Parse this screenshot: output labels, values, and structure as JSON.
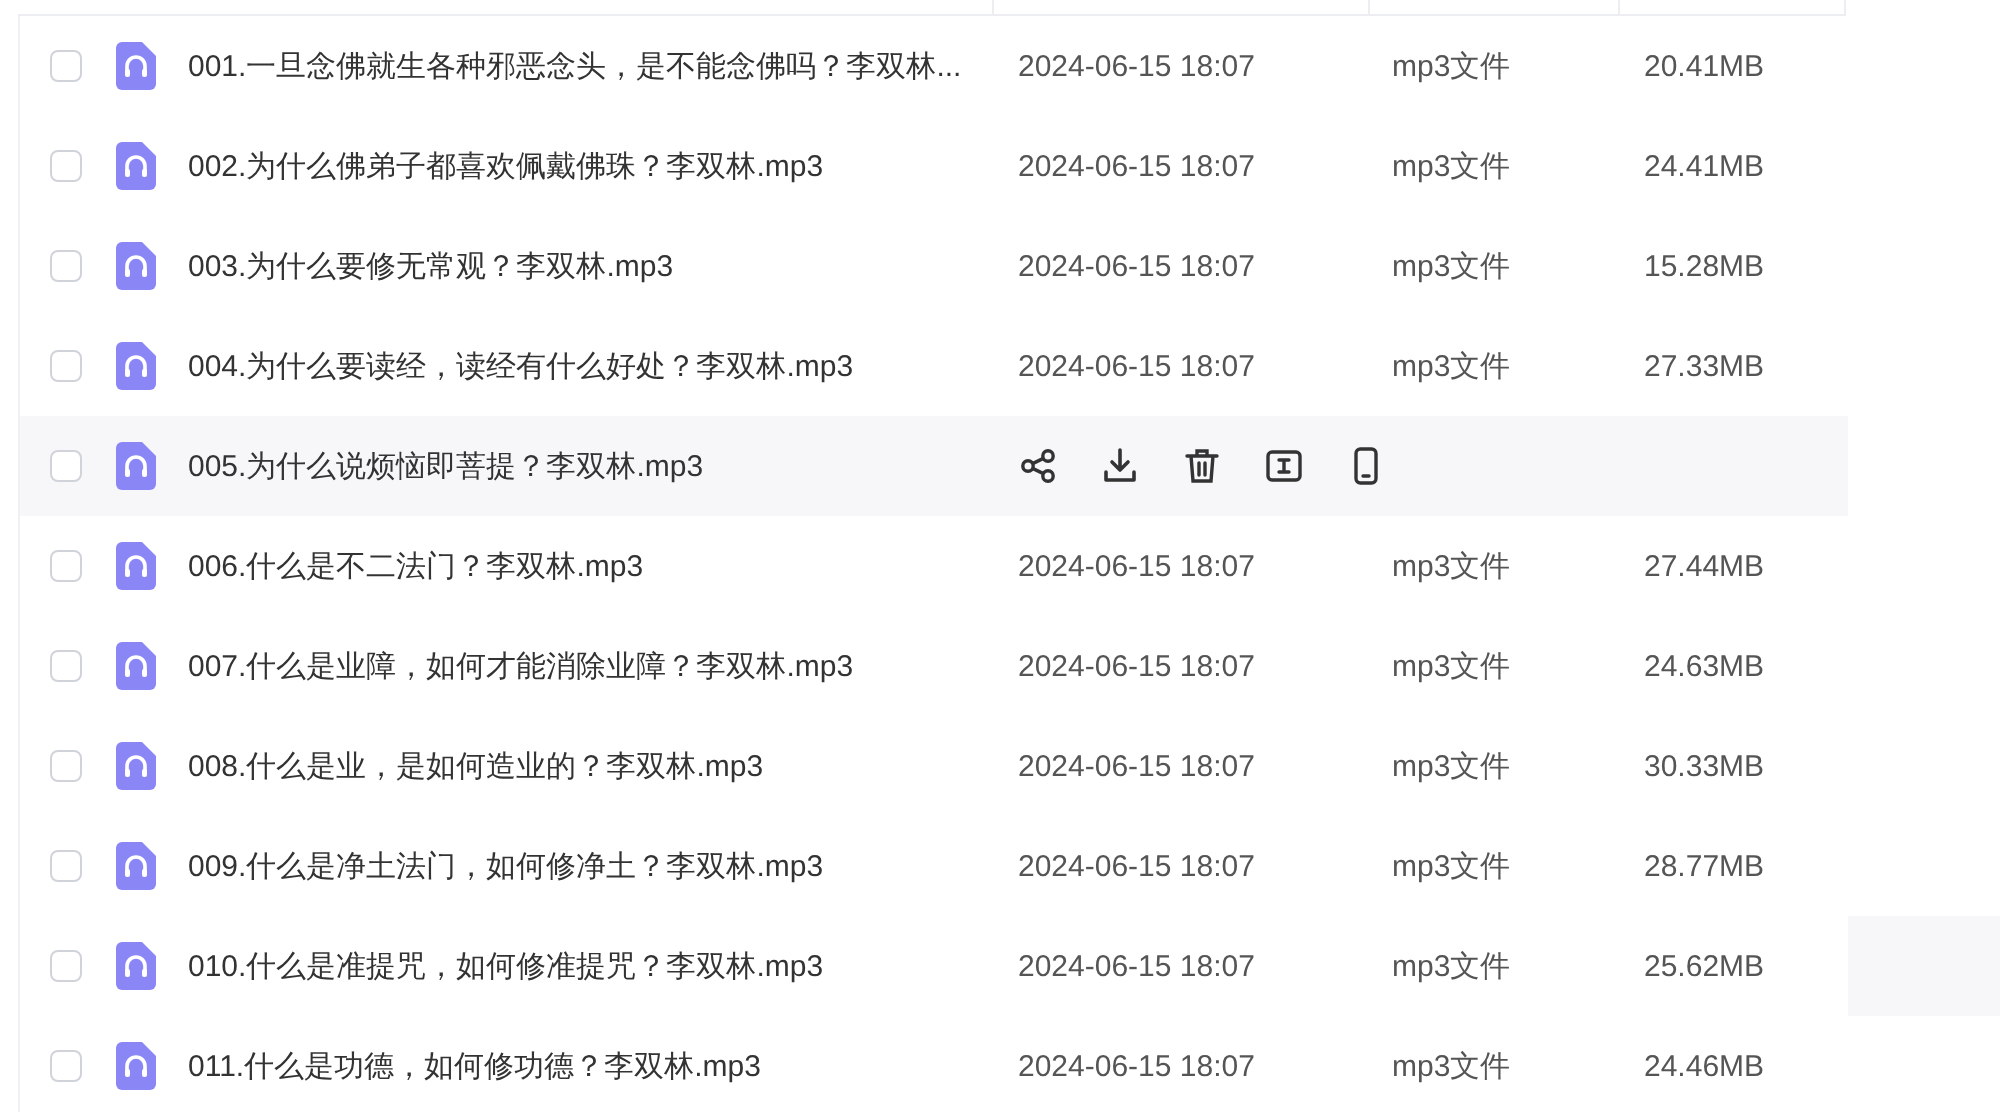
{
  "rows": [
    {
      "name": "001.一旦念佛就生各种邪恶念头，是不能念佛吗？李双林...",
      "date": "2024-06-15 18:07",
      "type": "mp3文件",
      "size": "20.41MB",
      "checked": false,
      "hovered": false
    },
    {
      "name": "002.为什么佛弟子都喜欢佩戴佛珠？李双林.mp3",
      "date": "2024-06-15 18:07",
      "type": "mp3文件",
      "size": "24.41MB",
      "checked": false,
      "hovered": false
    },
    {
      "name": "003.为什么要修无常观？李双林.mp3",
      "date": "2024-06-15 18:07",
      "type": "mp3文件",
      "size": "15.28MB",
      "checked": false,
      "hovered": false
    },
    {
      "name": "004.为什么要读经，读经有什么好处？李双林.mp3",
      "date": "2024-06-15 18:07",
      "type": "mp3文件",
      "size": "27.33MB",
      "checked": false,
      "hovered": false
    },
    {
      "name": "005.为什么说烦恼即菩提？李双林.mp3",
      "checked": false,
      "hovered": true
    },
    {
      "name": "006.什么是不二法门？李双林.mp3",
      "date": "2024-06-15 18:07",
      "type": "mp3文件",
      "size": "27.44MB",
      "checked": false,
      "hovered": false
    },
    {
      "name": "007.什么是业障，如何才能消除业障？李双林.mp3",
      "date": "2024-06-15 18:07",
      "type": "mp3文件",
      "size": "24.63MB",
      "checked": false,
      "hovered": false
    },
    {
      "name": "008.什么是业，是如何造业的？李双林.mp3",
      "date": "2024-06-15 18:07",
      "type": "mp3文件",
      "size": "30.33MB",
      "checked": false,
      "hovered": false
    },
    {
      "name": "009.什么是净土法门，如何修净土？李双林.mp3",
      "date": "2024-06-15 18:07",
      "type": "mp3文件",
      "size": "28.77MB",
      "checked": false,
      "hovered": false
    },
    {
      "name": "010.什么是准提咒，如何修准提咒？李双林.mp3",
      "date": "2024-06-15 18:07",
      "type": "mp3文件",
      "size": "25.62MB",
      "checked": false,
      "hovered": false
    },
    {
      "name": "011.什么是功德，如何修功德？李双林.mp3",
      "date": "2024-06-15 18:07",
      "type": "mp3文件",
      "size": "24.46MB",
      "checked": false,
      "hovered": false
    }
  ]
}
